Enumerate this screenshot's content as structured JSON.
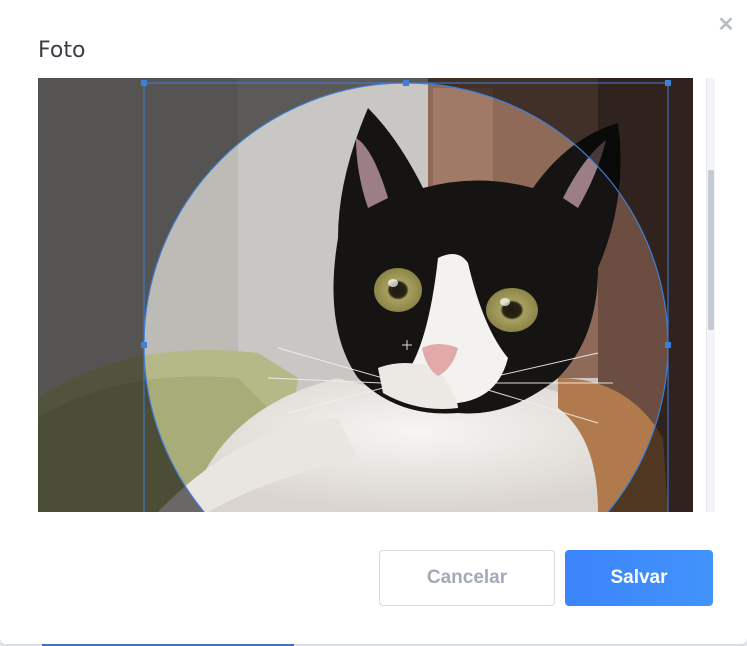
{
  "dialog": {
    "title": "Foto",
    "close_icon": "close-icon",
    "cancel_label": "Cancelar",
    "save_label": "Salvar"
  },
  "cropper": {
    "shape": "circle",
    "image_subject": "calico cat",
    "handles": [
      "top-left",
      "top-center",
      "top-right",
      "middle-left",
      "middle-right"
    ],
    "move_icon": "crosshair-icon"
  },
  "colors": {
    "primary": "#3d8bfd",
    "crop_border": "#3f7fd6",
    "title_text": "#3a3f47",
    "cancel_text": "#a3aab7"
  }
}
